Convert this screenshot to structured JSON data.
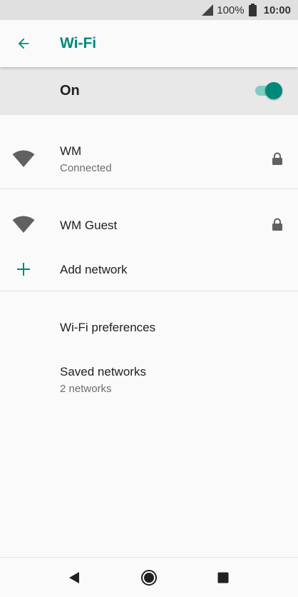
{
  "status_bar": {
    "battery_percent": "100%",
    "time": "10:00",
    "icons": [
      "signal-icon",
      "battery-icon"
    ]
  },
  "app_bar": {
    "title": "Wi-Fi",
    "back_icon": "arrow-left-icon"
  },
  "master_switch": {
    "label": "On",
    "state": true
  },
  "networks": [
    {
      "ssid": "WM",
      "status": "Connected",
      "secured": true,
      "icon": "wifi-signal-icon"
    },
    {
      "ssid": "WM Guest",
      "status": "",
      "secured": true,
      "icon": "wifi-signal-icon"
    }
  ],
  "add_network": {
    "label": "Add network",
    "icon": "plus-icon"
  },
  "preferences": {
    "label": "Wi-Fi preferences"
  },
  "saved_networks": {
    "label": "Saved networks",
    "summary": "2 networks"
  },
  "nav_bar": {
    "icons": [
      "back-triangle-icon",
      "home-circle-icon",
      "recents-square-icon"
    ]
  },
  "colors": {
    "accent": "#00897b",
    "accent_light": "#80cbc4",
    "header_bg": "#e8e8e8",
    "status_bg": "#e0e0e0",
    "icon_gray": "#616161"
  }
}
